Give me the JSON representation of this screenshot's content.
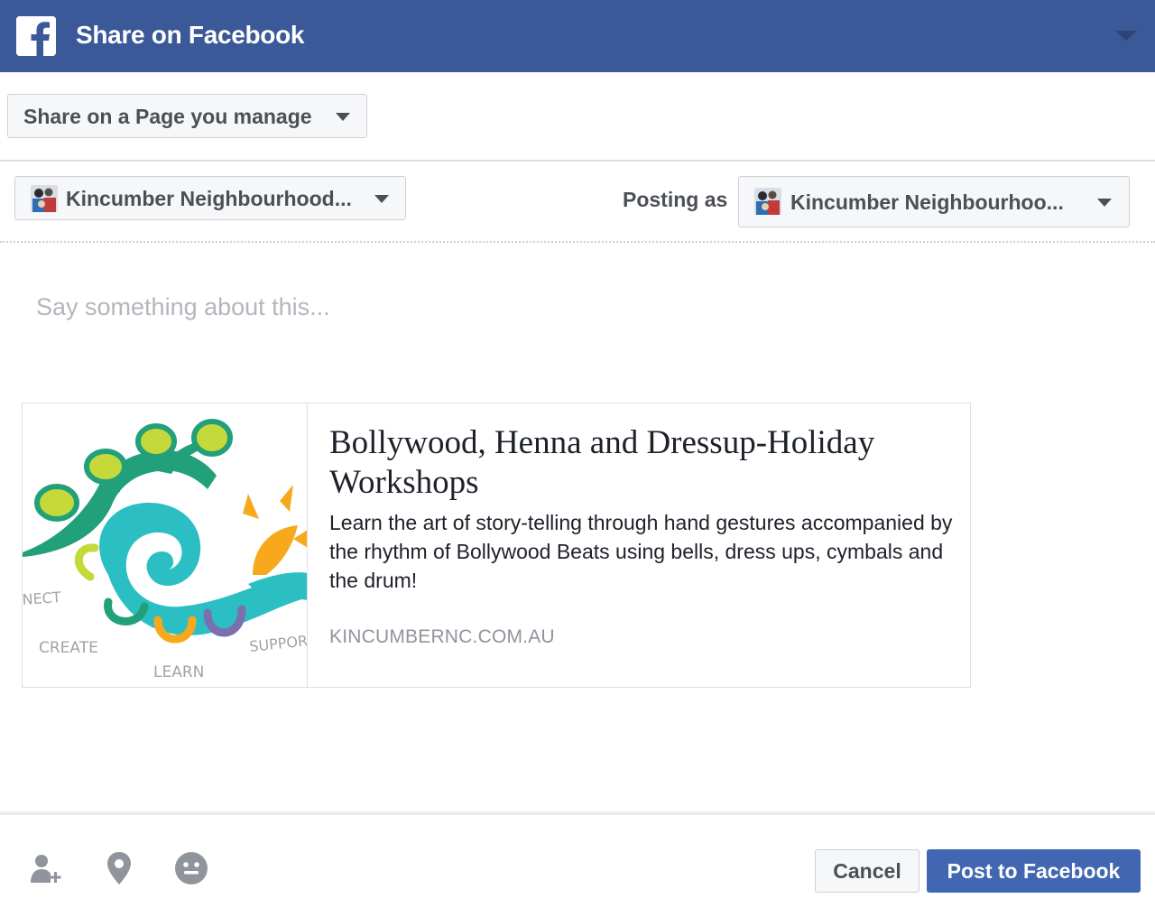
{
  "header": {
    "title": "Share on Facebook",
    "logo_icon": "facebook-f-icon",
    "menu_icon": "chevron-down-icon",
    "background_color": "#3b5998"
  },
  "share_target": {
    "selected": "Share on a Page you manage"
  },
  "page_select": {
    "selected": "Kincumber Neighbourhood..."
  },
  "posting_as": {
    "label": "Posting as",
    "selected": "Kincumber Neighbourhoo..."
  },
  "composer": {
    "placeholder": "Say something about this..."
  },
  "preview": {
    "title": "Bollywood, Henna and Dressup-Holiday Workshops",
    "description": "Learn the art of story-telling through hand gestures accompanied by the rhythm of Bollywood Beats using bells, dress ups, cymbals and the drum!",
    "domain": "KINCUMBERNC.COM.AU",
    "image_words": [
      "NECT",
      "CREATE",
      "LEARN",
      "SUPPOR"
    ]
  },
  "footer": {
    "tools": [
      "tag-people-icon",
      "location-pin-icon",
      "feeling-smiley-icon"
    ],
    "cancel_label": "Cancel",
    "post_label": "Post to Facebook",
    "post_color": "#4267b2"
  }
}
